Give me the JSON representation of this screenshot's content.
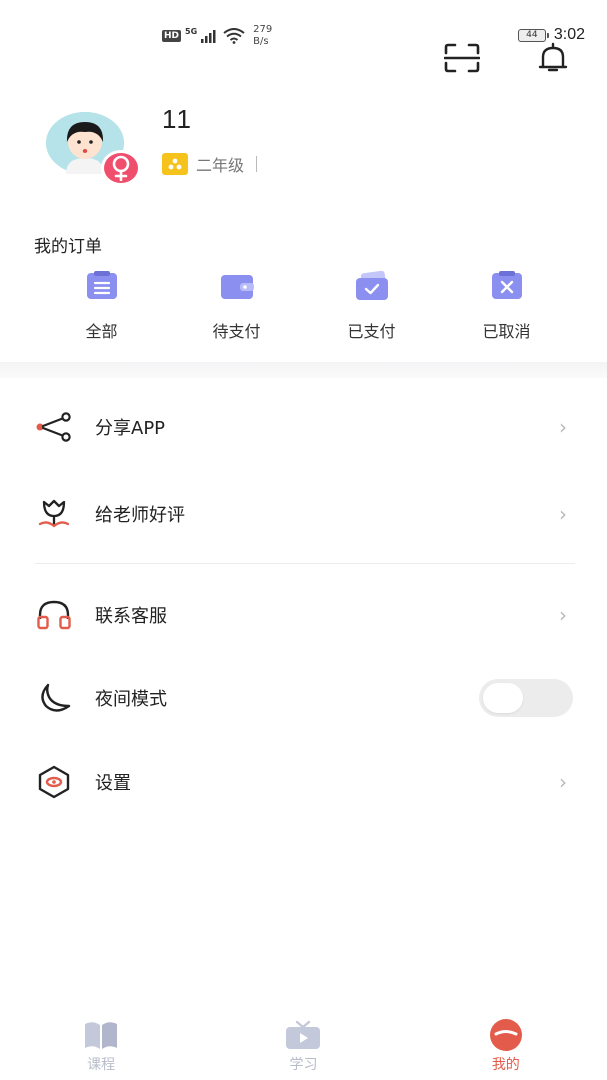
{
  "status_bar": {
    "hd": "HD",
    "network": "5G",
    "speed_value": "279",
    "speed_unit": "B/s",
    "battery": "44",
    "time": "3:02"
  },
  "header": {
    "scan_icon": "scan-icon",
    "bell_icon": "bell-icon"
  },
  "profile": {
    "username": "11",
    "grade": "二年级",
    "gender_icon": "female-icon"
  },
  "orders": {
    "title": "我的订单",
    "items": [
      {
        "label": "全部",
        "icon": "list-icon"
      },
      {
        "label": "待支付",
        "icon": "wallet-icon"
      },
      {
        "label": "已支付",
        "icon": "card-check-icon"
      },
      {
        "label": "已取消",
        "icon": "clipboard-x-icon"
      }
    ]
  },
  "menu": [
    {
      "label": "分享APP",
      "icon": "share-icon"
    },
    {
      "label": "给老师好评",
      "icon": "flower-icon"
    },
    {
      "label": "联系客服",
      "icon": "headphones-icon"
    },
    {
      "label": "夜间模式",
      "icon": "moon-icon",
      "toggle": false
    },
    {
      "label": "设置",
      "icon": "settings-icon"
    }
  ],
  "tabs": [
    {
      "label": "课程",
      "icon": "book-icon",
      "active": false
    },
    {
      "label": "学习",
      "icon": "tv-icon",
      "active": false
    },
    {
      "label": "我的",
      "icon": "face-icon",
      "active": true
    }
  ],
  "colors": {
    "accent": "#e35c4b",
    "order_icon": "#8a8ff0",
    "badge": "#ef4f6d",
    "grade_badge": "#f6c21c",
    "tab_inactive": "#b9bccb"
  }
}
